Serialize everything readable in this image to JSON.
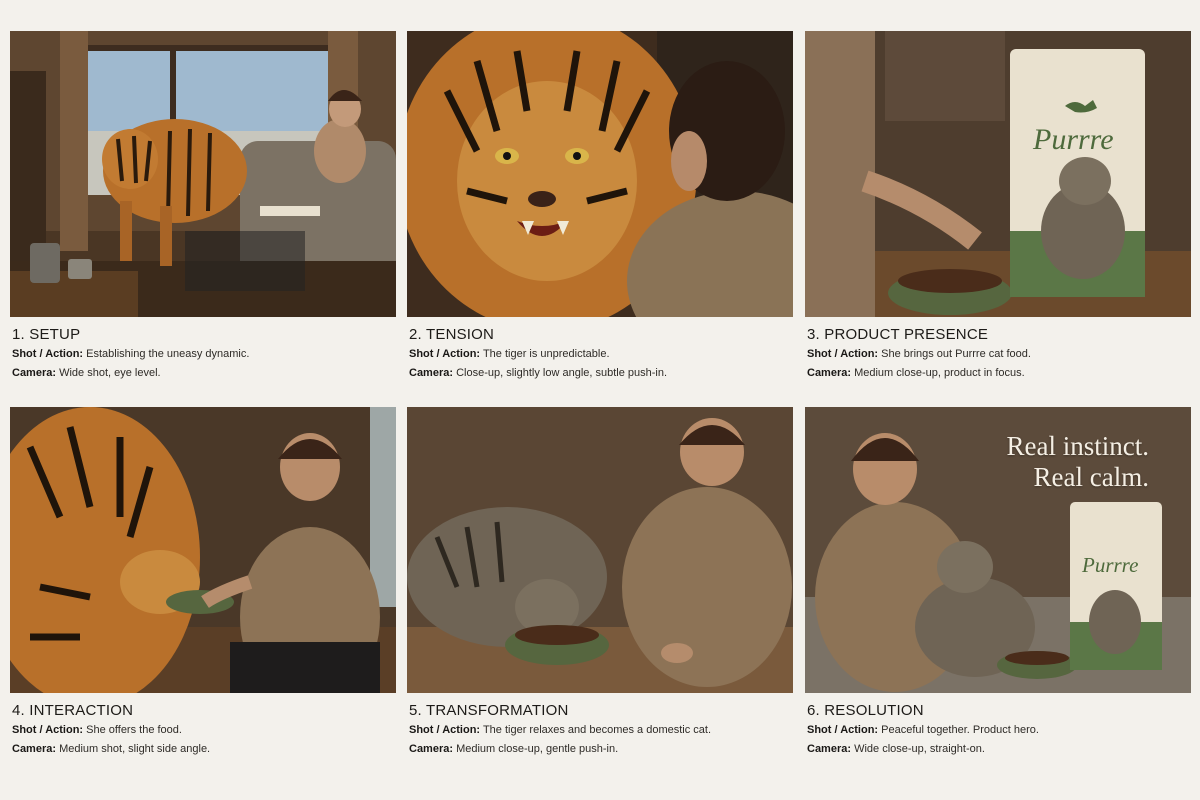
{
  "panels": [
    {
      "title": "1. SETUP",
      "shot_label": "Shot / Action:",
      "shot": "Establishing the uneasy dynamic.",
      "camera_label": "Camera:",
      "camera": "Wide shot, eye level."
    },
    {
      "title": "2. TENSION",
      "shot_label": "Shot / Action:",
      "shot": "The tiger is unpredictable.",
      "camera_label": "Camera:",
      "camera": "Close-up, slightly low angle, subtle push-in."
    },
    {
      "title": "3. PRODUCT PRESENCE",
      "shot_label": "Shot / Action:",
      "shot": "She brings out Purrre cat food.",
      "camera_label": "Camera:",
      "camera": "Medium close-up, product in focus."
    },
    {
      "title": "4. INTERACTION",
      "shot_label": "Shot / Action:",
      "shot": "She offers the food.",
      "camera_label": "Camera:",
      "camera": "Medium shot, slight side angle."
    },
    {
      "title": "5. TRANSFORMATION",
      "shot_label": "Shot / Action:",
      "shot": "The tiger relaxes and becomes a domestic cat.",
      "camera_label": "Camera:",
      "camera": "Medium close-up, gentle push-in."
    },
    {
      "title": "6. RESOLUTION",
      "shot_label": "Shot / Action:",
      "shot": "Peaceful together. Product hero.",
      "camera_label": "Camera:",
      "camera": "Wide close-up, straight-on."
    }
  ],
  "brand": {
    "name": "Purrre"
  },
  "tagline": {
    "line1": "Real instinct.",
    "line2": "Real calm."
  },
  "colors": {
    "page_bg": "#f3f1ec",
    "bag_green": "#5b7747",
    "bag_cream": "#e9e1cf",
    "tiger_orange": "#b8702a"
  }
}
